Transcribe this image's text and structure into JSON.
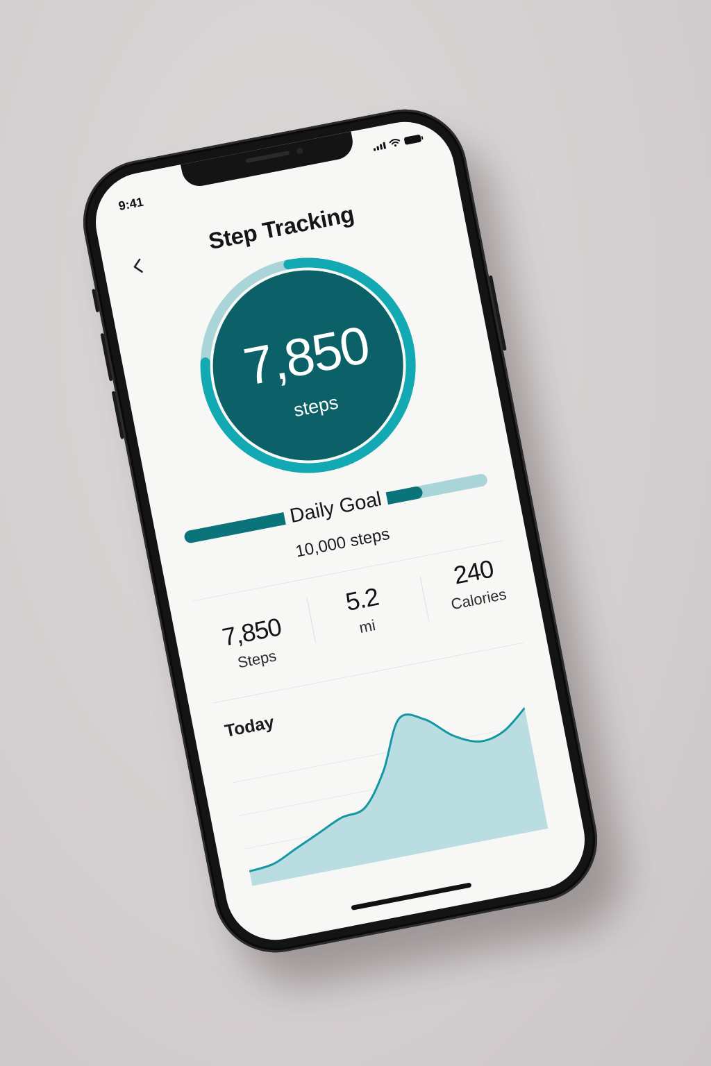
{
  "status_bar": {
    "time": "9:41",
    "signal_icon": "signal-icon",
    "wifi_icon": "wifi-icon",
    "battery_icon": "battery-icon"
  },
  "header": {
    "back_icon": "chevron-left-icon",
    "title": "Step Tracking"
  },
  "progress_ring": {
    "value": "7,850",
    "unit": "steps",
    "progress_fraction": 0.785,
    "color_track": "#a9d5d8",
    "color_progress": "#12a9b3",
    "color_center": "#0c6168"
  },
  "daily_goal": {
    "label": "Daily Goal",
    "target": "10,000 steps",
    "progress_fraction": 0.785,
    "color_fill": "#0b737a",
    "color_track": "#a9d5d8"
  },
  "stats": [
    {
      "value": "7,850",
      "label": "Steps"
    },
    {
      "value": "5.2",
      "label": "mi"
    },
    {
      "value": "240",
      "label": "Calories"
    }
  ],
  "today": {
    "label": "Today"
  },
  "chart_data": {
    "type": "area",
    "title": "Today",
    "xlabel": "",
    "ylabel": "",
    "ylim": [
      0,
      100
    ],
    "x": [
      0,
      1,
      2,
      3,
      4,
      5,
      6,
      7,
      8,
      9,
      10,
      11,
      12
    ],
    "series": [
      {
        "values": [
          8,
          10,
          18,
          26,
          34,
          38,
          62,
          98,
          94,
          78,
          70,
          74,
          88
        ]
      }
    ],
    "grid": true,
    "line_color": "#1597a3",
    "fill_color": "#b9dde1"
  }
}
